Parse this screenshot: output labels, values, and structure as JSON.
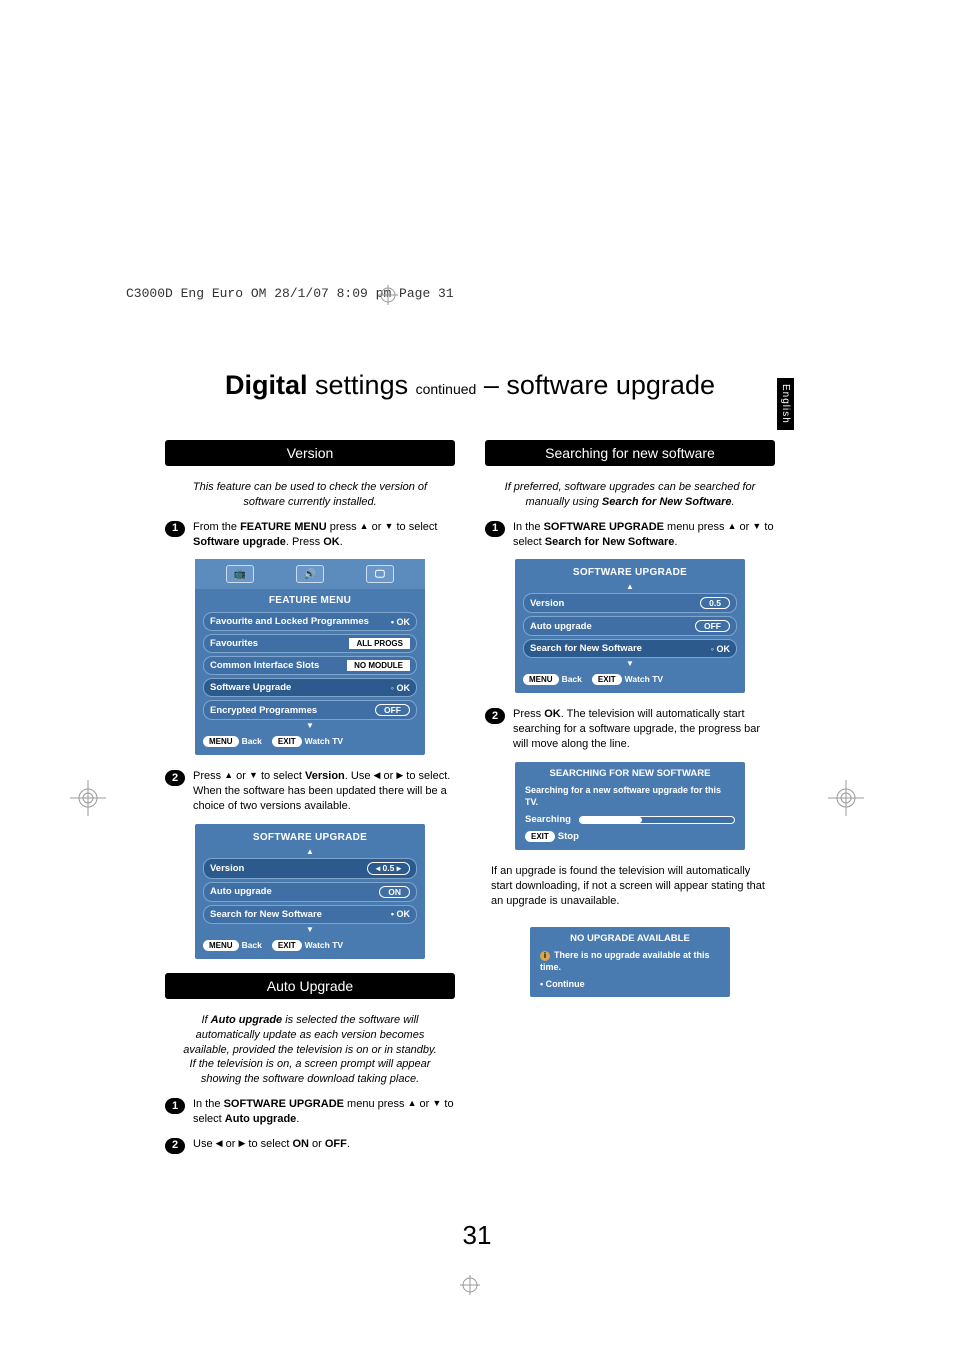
{
  "header_line": "C3000D Eng Euro OM  28/1/07  8:09 pm  Page 31",
  "main_title": {
    "bold": "Digital",
    "mid": " settings ",
    "cont": "continued",
    "dash": " – ",
    "rest": "software upgrade"
  },
  "lang": "English",
  "page_number": "31",
  "left": {
    "version": {
      "header": "Version",
      "intro": "This feature can be used to check the version of software currently installed.",
      "step1_a": "From the ",
      "step1_b": "FEATURE MENU",
      "step1_c": " press ",
      "step1_d": " or ",
      "step1_e": " to select ",
      "step1_f": "Software upgrade",
      "step1_g": ". Press ",
      "step1_h": "OK",
      "step1_i": ".",
      "step2_a": "Press ",
      "step2_b": " or ",
      "step2_c": " to select ",
      "step2_d": "Version",
      "step2_e": ". Use ",
      "step2_f": " or ",
      "step2_g": " to select. When the software has been updated there will be a choice of two versions available."
    },
    "feature_menu": {
      "title": "FEATURE MENU",
      "rows": [
        {
          "label": "Favourite and Locked Programmes",
          "val": "OK",
          "style": "ok"
        },
        {
          "label": "Favourites",
          "val": "ALL PROGS",
          "style": "box"
        },
        {
          "label": "Common Interface Slots",
          "val": "NO MODULE",
          "style": "box"
        },
        {
          "label": "Software Upgrade",
          "val": "OK",
          "style": "nav"
        },
        {
          "label": "Encrypted Programmes",
          "val": "OFF",
          "style": "round"
        }
      ],
      "footer_menu": "MENU",
      "footer_back": "Back",
      "footer_exit": "EXIT",
      "footer_watch": "Watch TV"
    },
    "sw_upgrade1": {
      "title": "SOFTWARE UPGRADE",
      "rows": [
        {
          "label": "Version",
          "val": "0.5",
          "style": "sel-round"
        },
        {
          "label": "Auto upgrade",
          "val": "ON",
          "style": "round"
        },
        {
          "label": "Search for New Software",
          "val": "OK",
          "style": "ok"
        }
      ],
      "footer_menu": "MENU",
      "footer_back": "Back",
      "footer_exit": "EXIT",
      "footer_watch": "Watch TV"
    },
    "auto_upgrade": {
      "header": "Auto Upgrade",
      "intro_a": "If ",
      "intro_b": "Auto upgrade",
      "intro_c": " is selected the software will automatically update as each version becomes available, provided the television is on or in standby. If the television is on, a screen prompt will appear showing the software download taking place.",
      "step1_a": "In the ",
      "step1_b": "SOFTWARE UPGRADE",
      "step1_c": " menu press ",
      "step1_d": " or ",
      "step1_e": " to select ",
      "step1_f": "Auto upgrade",
      "step1_g": ".",
      "step2_a": "Use ",
      "step2_b": " or ",
      "step2_c": " to select ",
      "step2_d": "ON",
      "step2_e": " or ",
      "step2_f": "OFF",
      "step2_g": "."
    }
  },
  "right": {
    "search": {
      "header": "Searching for new software",
      "intro_a": "If preferred, software upgrades can be searched for manually using ",
      "intro_b": "Search for New Software",
      "intro_c": ".",
      "step1_a": "In the ",
      "step1_b": "SOFTWARE UPGRADE",
      "step1_c": " menu press ",
      "step1_d": " or ",
      "step1_e": " to select ",
      "step1_f": "Search for New Software",
      "step1_g": ".",
      "step2_a": "Press ",
      "step2_b": "OK",
      "step2_c": ". The television will automatically start searching for a software upgrade, the progress bar will move along the line.",
      "post_a": "If an upgrade is found the television will automatically start downloading, if not a screen will appear stating that an upgrade is unavailable."
    },
    "sw_upgrade2": {
      "title": "SOFTWARE UPGRADE",
      "rows": [
        {
          "label": "Version",
          "val": "0.5",
          "style": "round"
        },
        {
          "label": "Auto upgrade",
          "val": "OFF",
          "style": "round"
        },
        {
          "label": "Search for New Software",
          "val": "OK",
          "style": "nav"
        }
      ],
      "footer_menu": "MENU",
      "footer_back": "Back",
      "footer_exit": "EXIT",
      "footer_watch": "Watch TV"
    },
    "searching_panel": {
      "title": "SEARCHING FOR NEW SOFTWARE",
      "msg": "Searching for a new software upgrade for this TV.",
      "label": "Searching",
      "exit": "EXIT",
      "stop": "Stop"
    },
    "noupgrade": {
      "title": "NO UPGRADE AVAILABLE",
      "msg": "There is no upgrade available at this time.",
      "cont": "Continue"
    }
  }
}
